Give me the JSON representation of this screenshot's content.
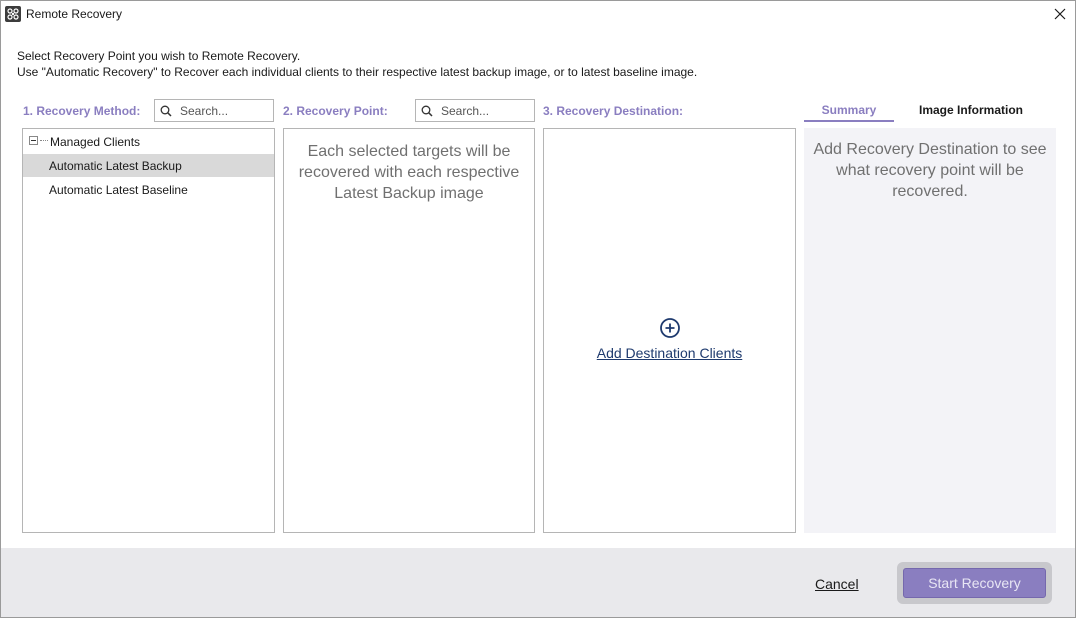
{
  "window": {
    "title": "Remote Recovery",
    "icon": "app-logo-icon",
    "close_icon": "close-icon"
  },
  "instructions": {
    "line1": "Select Recovery Point you wish to Remote Recovery.",
    "line2": "Use \"Automatic Recovery\" to Recover each individual clients to their respective latest backup image, or to latest baseline image."
  },
  "columns": {
    "method": {
      "header": "1. Recovery Method:",
      "search_placeholder": "Search...",
      "tree": {
        "root_label": "Managed Clients",
        "items": [
          {
            "label": "Automatic Latest Backup",
            "selected": true
          },
          {
            "label": "Automatic Latest Baseline",
            "selected": false
          }
        ]
      }
    },
    "point": {
      "header": "2. Recovery Point:",
      "search_placeholder": "Search...",
      "placeholder": "Each selected targets will be recovered with each respective Latest Backup image"
    },
    "destination": {
      "header": "3. Recovery Destination:",
      "add_label": "Add Destination Clients",
      "add_icon": "plus-circle-icon"
    }
  },
  "tabs": [
    {
      "label": "Summary",
      "active": true
    },
    {
      "label": "Image Information",
      "active": false
    }
  ],
  "summary": {
    "text": "Add Recovery Destination to see what recovery point will be recovered."
  },
  "footer": {
    "cancel_label": "Cancel",
    "start_label": "Start Recovery"
  },
  "colors": {
    "accent": "#8a7ec0",
    "link": "#1e3a6e",
    "selected_row": "#d9d9d9",
    "footer_bg": "#e9e9ec"
  }
}
